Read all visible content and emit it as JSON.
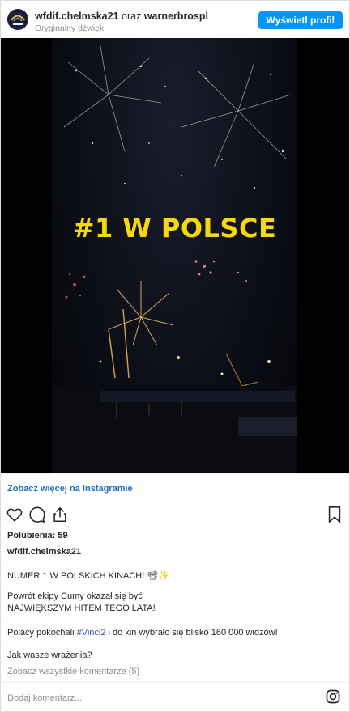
{
  "header": {
    "username": "wfdif.chelmska21",
    "conjunction": "oraz",
    "collaborator": "warnerbrospl",
    "audio": "Oryginalny dźwięk",
    "view_profile_label": "Wyświetl profil"
  },
  "media": {
    "headline": "#1 W POLSCE"
  },
  "see_more_label": "Zobacz więcej na Instagramie",
  "actions": {
    "like_icon": "heart-icon",
    "comment_icon": "comment-icon",
    "share_icon": "share-icon",
    "save_icon": "bookmark-icon"
  },
  "likes_text": "Polubienia: 59",
  "caption": {
    "username": "wfdif.chelmska21",
    "line1": "NUMER 1 W POLSKICH KINACH! 📽✨",
    "line2": "Powrót ekipy Cumy okazał się być",
    "line3": "NAJWIĘKSZYM HITEM TEGO LATA!",
    "line4_pre": "Polacy pokochali ",
    "line4_hashtag": "#Vinci2",
    "line4_post": " i do kin wybrało się blisko 160 000 widzów!",
    "line5": "Jak wasze wrażenia?"
  },
  "view_comments_label": "Zobacz wszystkie komentarze (5)",
  "add_comment_placeholder": "Dodaj komentarz...",
  "colors": {
    "accent": "#0095f6",
    "link": "#1f6fbf",
    "headline": "#f5d90a"
  }
}
